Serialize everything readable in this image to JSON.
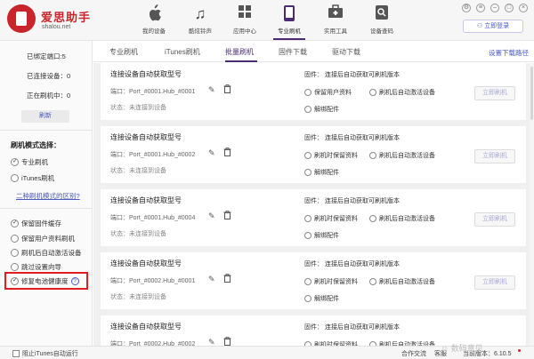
{
  "app": {
    "brand_name": "爱思助手",
    "brand_url": "shalou.net",
    "nav": [
      {
        "label": "我的设备",
        "icon": "apple-icon"
      },
      {
        "label": "酷炫铃声",
        "icon": "music-note-icon"
      },
      {
        "label": "应用中心",
        "icon": "grid-icon"
      },
      {
        "label": "专业刷机",
        "icon": "phone-icon"
      },
      {
        "label": "实用工具",
        "icon": "toolbox-icon"
      },
      {
        "label": "设备查码",
        "icon": "search-device-icon"
      }
    ],
    "active_nav": "专业刷机",
    "login_label": "立即登录",
    "accent_color": "#4b2c74",
    "brand_color": "#c8262c"
  },
  "sidebar": {
    "stats": [
      {
        "label": "已绑定端口:5"
      },
      {
        "label": "已连接设备：0"
      },
      {
        "label": "正在刷机中：0"
      }
    ],
    "refresh_label": "刷新",
    "mode_title": "刷机模式选择：",
    "modes": [
      {
        "label": "专业刷机",
        "checked": true
      },
      {
        "label": "iTunes刷机",
        "checked": false
      }
    ],
    "diff_link": "二种刷机模式的区别?",
    "options": [
      {
        "label": "保留固件缓存",
        "checked": true
      },
      {
        "label": "保留用户资料刷机",
        "checked": false
      },
      {
        "label": "刷机后自动激活设备",
        "checked": false
      },
      {
        "label": "跳过设置向导",
        "checked": false
      },
      {
        "label": "修复电池健康度",
        "checked": true,
        "help": "?"
      }
    ]
  },
  "tabs": {
    "items": [
      "专业刷机",
      "iTunes刷机",
      "批量刷机",
      "固件下载",
      "驱动下载"
    ],
    "active": "批量刷机",
    "path_link": "设置下载路径"
  },
  "cards": [
    {
      "title": "连接设备自动获取型号",
      "port": "端口：Port_#0001.Hub_#0001",
      "status": "状态：未连接到设备",
      "firmware": "固件：  连接后自动获取可刷机版本",
      "opt_keep": "保留用户资料",
      "opt_activate": "刷机后自动激活设备",
      "opt_unlock": "解绑配件",
      "flash": "立即刷机"
    },
    {
      "title": "连接设备自动获取型号",
      "port": "端口：Port_#0001.Hub_#0002",
      "status": "状态：未连接到设备",
      "firmware": "固件：  连接后自动获取可刷机版本",
      "opt_keep": "刷机时保留资料",
      "opt_activate": "刷机后自动激活设备",
      "opt_unlock": "解绑配件",
      "flash": "立即刷机"
    },
    {
      "title": "连接设备自动获取型号",
      "port": "端口：Port_#0001.Hub_#0004",
      "status": "状态：未连接到设备",
      "firmware": "固件：  连接后自动获取可刷机版本",
      "opt_keep": "刷机时保留资料",
      "opt_activate": "刷机后自动激活设备",
      "opt_unlock": "解绑配件",
      "flash": "立即刷机"
    },
    {
      "title": "连接设备自动获取型号",
      "port": "端口：Port_#0002.Hub_#0001",
      "status": "状态：未连接到设备",
      "firmware": "固件：  连接后自动获取可刷机版本",
      "opt_keep": "刷机时保留资料",
      "opt_activate": "刷机后自动激活设备",
      "opt_unlock": "解绑配件",
      "flash": "立即刷机"
    },
    {
      "title": "连接设备自动获取型号",
      "port": "端口：Port_#0002.Hub_#0002",
      "status": "",
      "firmware": "固件：  连接后自动获取可刷机版本",
      "opt_keep": "刷机时保留资料",
      "opt_activate": "刷机后自动激活设备",
      "opt_unlock": "",
      "flash": ""
    }
  ],
  "footer": {
    "block_itunes": "阻止iTunes自动运行",
    "feedback": "合作交流",
    "support": "客服",
    "version": "当前版本：6.10.5",
    "watermark": "数码意见"
  }
}
